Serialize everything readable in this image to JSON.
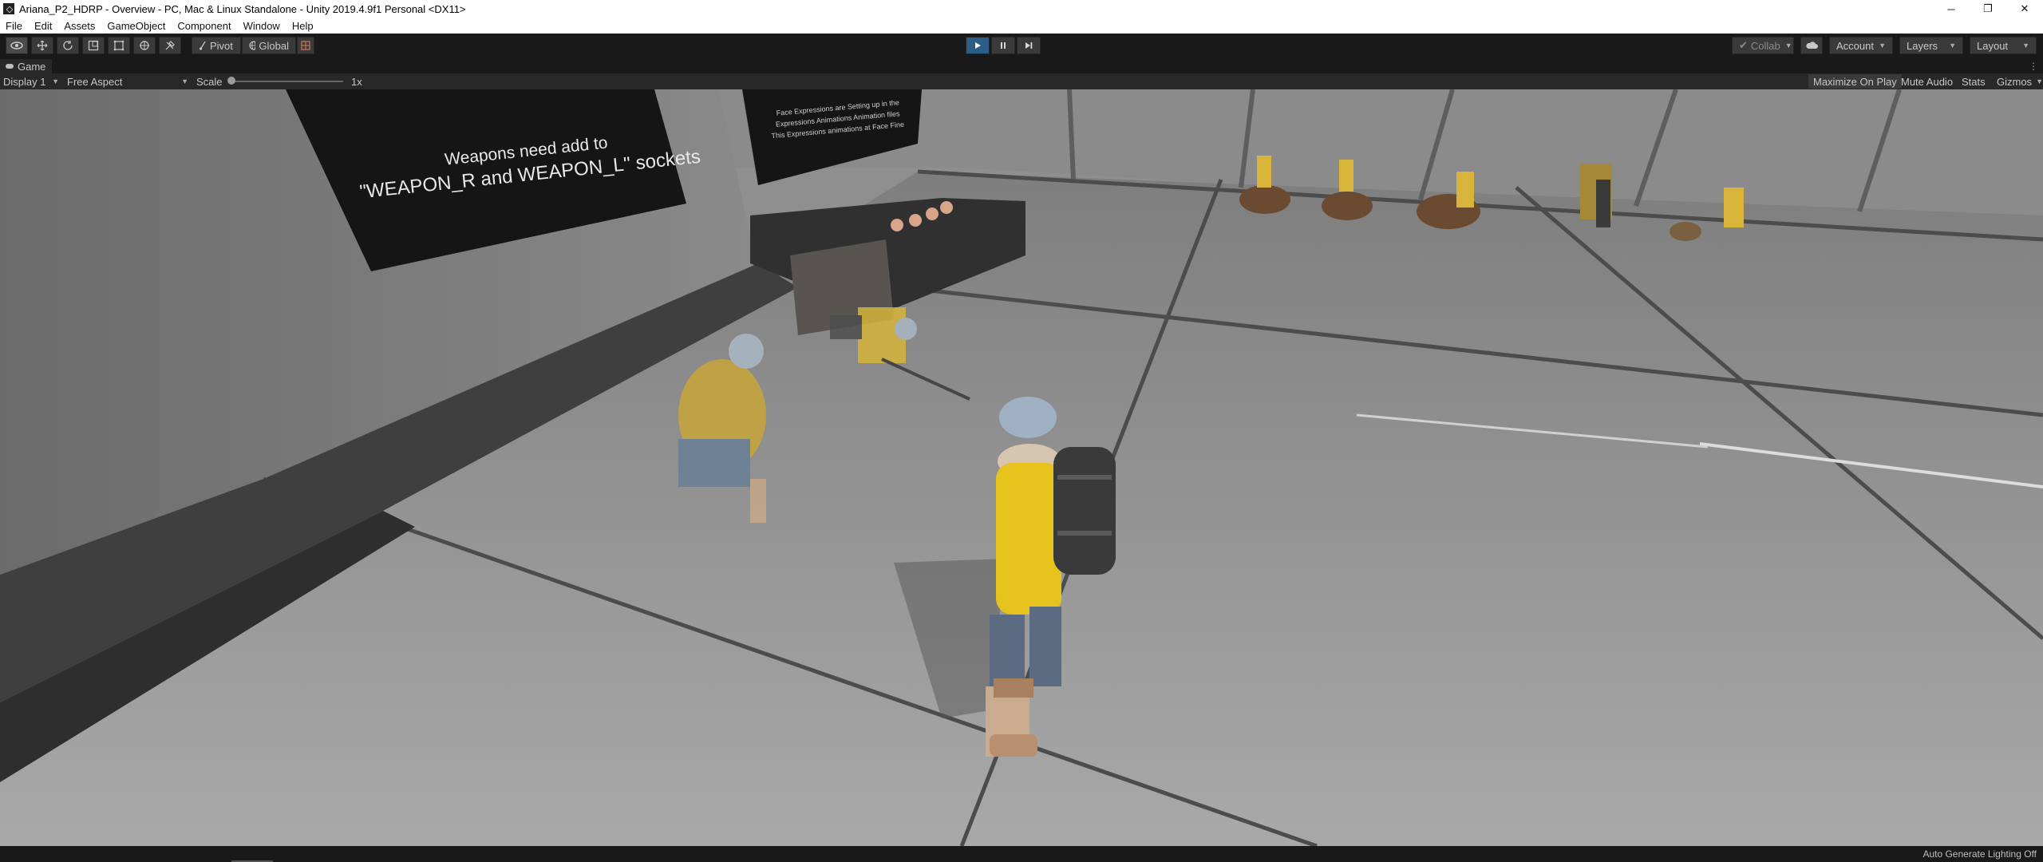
{
  "window": {
    "title": "Ariana_P2_HDRP - Overview - PC, Mac & Linux Standalone - Unity 2019.4.9f1 Personal <DX11>",
    "controls": [
      "─",
      "❐",
      "✕"
    ]
  },
  "menu": [
    "File",
    "Edit",
    "Assets",
    "GameObject",
    "Component",
    "Window",
    "Help"
  ],
  "toolbar": {
    "tool_icons": [
      "hand-icon",
      "move-icon",
      "rotate-icon",
      "scale-icon",
      "rect-icon",
      "transform-icon",
      "custom-tool-icon"
    ],
    "pivot_label": "Pivot",
    "global_label": "Global",
    "play_icons": [
      "▶",
      "❚❚",
      "▶❚"
    ],
    "collab_label": "Collab",
    "account_label": "Account",
    "layers_label": "Layers",
    "layout_label": "Layout"
  },
  "game_tab": {
    "label": "Game",
    "display_label": "Display 1",
    "aspect_label": "Free Aspect",
    "scale_label": "Scale",
    "scale_value": 1,
    "scale_value_text": "1x",
    "maximize_label": "Maximize On Play",
    "mute_label": "Mute Audio",
    "stats_label": "Stats",
    "gizmos_label": "Gizmos"
  },
  "scene": {
    "sign_left_line1": "Weapons need add to",
    "sign_left_line2": "\"WEAPON_R and WEAPON_L\" sockets",
    "sign_right_line1": "Face Expressions are Setting up in the",
    "sign_right_line2": "Expressions Animations Animation files",
    "sign_right_line3": "This Expressions animations at Face Fine"
  },
  "status": {
    "text": "Auto Generate Lighting Off"
  },
  "colors": {
    "editor_dark": "#191919",
    "panel": "#282828",
    "play_active": "#2c5d87",
    "character_jacket": "#e6c21c"
  }
}
